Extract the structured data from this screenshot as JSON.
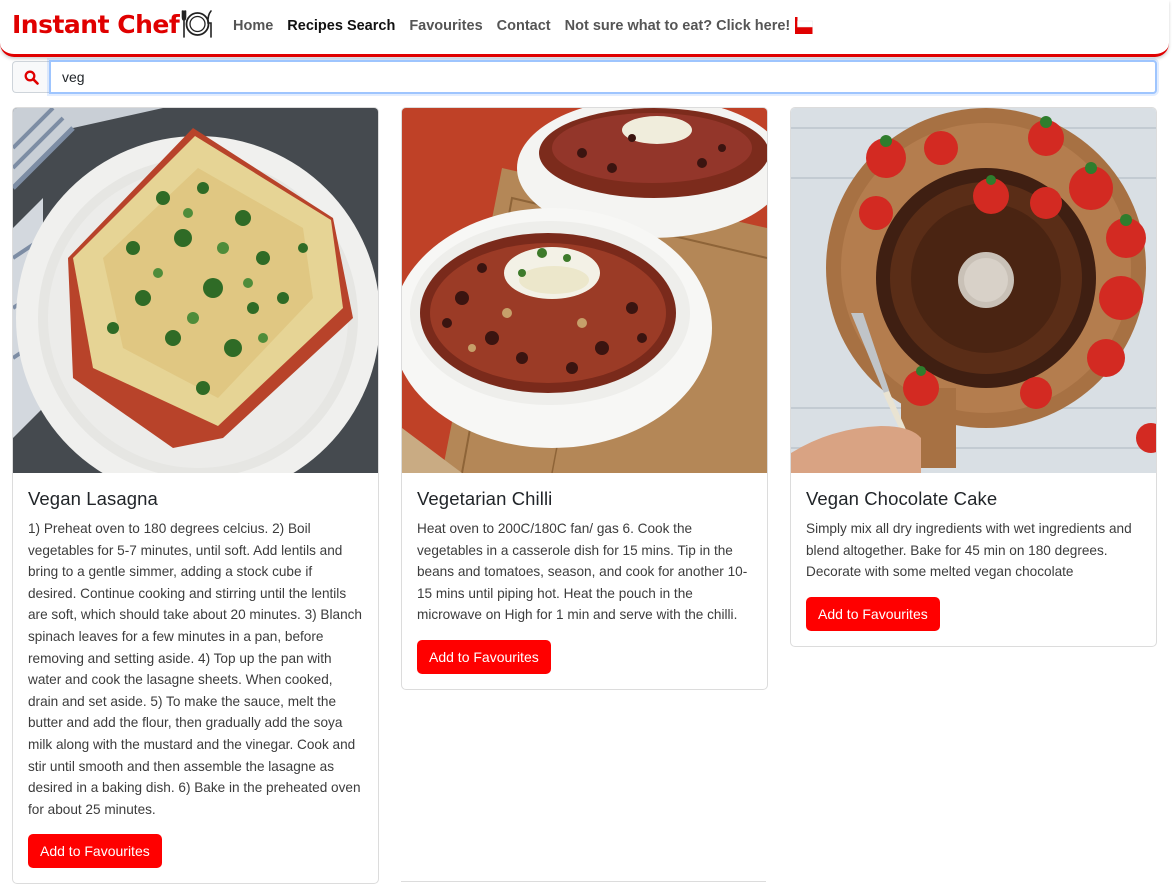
{
  "brand": {
    "name": "Instant Chef",
    "icon": "plate-fork-knife-icon",
    "color": "#e00000"
  },
  "nav": {
    "items": [
      {
        "label": "Home",
        "active": false
      },
      {
        "label": "Recipes Search",
        "active": true
      },
      {
        "label": "Favourites",
        "active": false
      },
      {
        "label": "Contact",
        "active": false
      },
      {
        "label": "Not sure what to eat? Click here!",
        "active": false,
        "icon": "flag-icon"
      }
    ]
  },
  "search": {
    "icon": "search-icon",
    "value": "veg"
  },
  "recipes": [
    {
      "title": "Vegan Lasagna",
      "image": "vegan-lasagna-photo",
      "text": "1) Preheat oven to 180 degrees celcius. 2) Boil vegetables for 5-7 minutes, until soft. Add lentils and bring to a gentle simmer, adding a stock cube if desired. Continue cooking and stirring until the lentils are soft, which should take about 20 minutes. 3) Blanch spinach leaves for a few minutes in a pan, before removing and setting aside. 4) Top up the pan with water and cook the lasagne sheets. When cooked, drain and set aside. 5) To make the sauce, melt the butter and add the flour, then gradually add the soya milk along with the mustard and the vinegar. Cook and stir until smooth and then assemble the lasagne as desired in a baking dish. 6) Bake in the preheated oven for about 25 minutes.",
      "button": "Add to Favourites"
    },
    {
      "title": "Vegetarian Chilli",
      "image": "vegetarian-chilli-photo",
      "text": "Heat oven to 200C/180C fan/ gas 6. Cook the vegetables in a casserole dish for 15 mins. Tip in the beans and tomatoes, season, and cook for another 10-15 mins until piping hot. Heat the pouch in the microwave on High for 1 min and serve with the chilli.",
      "button": "Add to Favourites"
    },
    {
      "title": "Vegan Chocolate Cake",
      "image": "vegan-chocolate-cake-photo",
      "text": "Simply mix all dry ingredients with wet ingredients and blend altogether. Bake for 45 min on 180 degrees. Decorate with some melted vegan chocolate",
      "button": "Add to Favourites"
    }
  ],
  "colors": {
    "accent": "#ff0000",
    "focus_border": "#9ec5fe"
  }
}
